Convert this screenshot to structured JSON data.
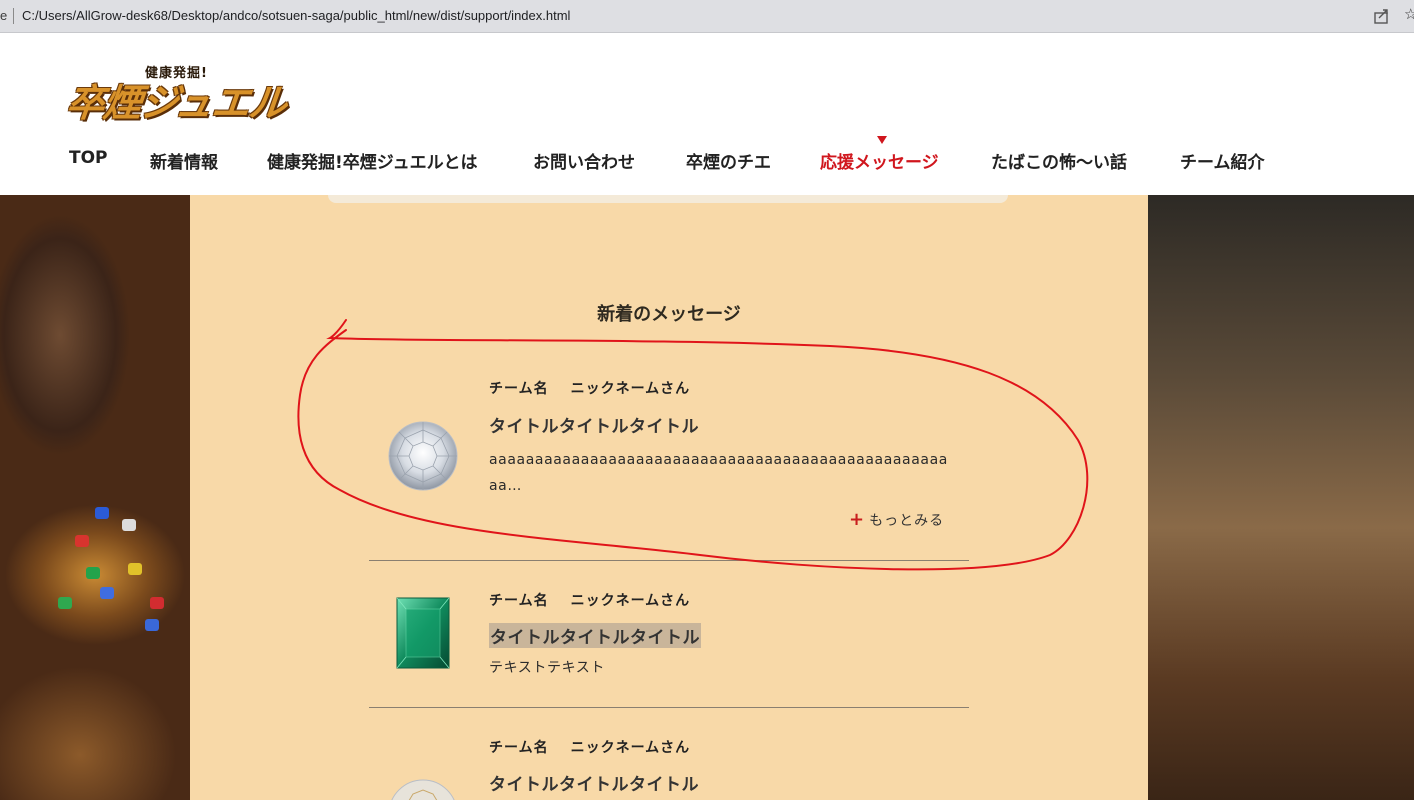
{
  "browser": {
    "lead_char": "e",
    "url": "C:/Users/AllGrow-desk68/Desktop/andco/sotsuen-saga/public_html/new/dist/support/index.html",
    "star": "☆"
  },
  "logo": {
    "small_text": "健康発掘!",
    "main_text": "卒煙ジュエル"
  },
  "nav": {
    "items": [
      {
        "label": "TOP"
      },
      {
        "label": "新着情報"
      },
      {
        "label": "健康発掘!卒煙ジュエルとは"
      },
      {
        "label": "お問い合わせ"
      },
      {
        "label": "卒煙のチエ"
      },
      {
        "label": "応援メッセージ"
      },
      {
        "label": "たばこの怖〜い話"
      },
      {
        "label": "チーム紹介"
      }
    ],
    "active_index": 5
  },
  "section": {
    "title": "新着のメッセージ"
  },
  "messages": [
    {
      "team": "チーム名",
      "nickname": "ニックネームさん",
      "title": "タイトルタイトルタイトル",
      "body": "aaaaaaaaaaaaaaaaaaaaaaaaaaaaaaaaaaaaaaaaaaaaaaaaaaaa…",
      "more": "もっとみる",
      "icon": "diamond-icon"
    },
    {
      "team": "チーム名",
      "nickname": "ニックネームさん",
      "title": "タイトルタイトルタイトル",
      "body": "テキストテキスト",
      "icon": "emerald-icon"
    },
    {
      "team": "チーム名",
      "nickname": "ニックネームさん",
      "title": "タイトルタイトルタイトル",
      "icon": "diamond-icon"
    }
  ],
  "colors": {
    "accent": "#d0161d",
    "paper": "#f8d9a8",
    "annotation": "#e0141a"
  }
}
